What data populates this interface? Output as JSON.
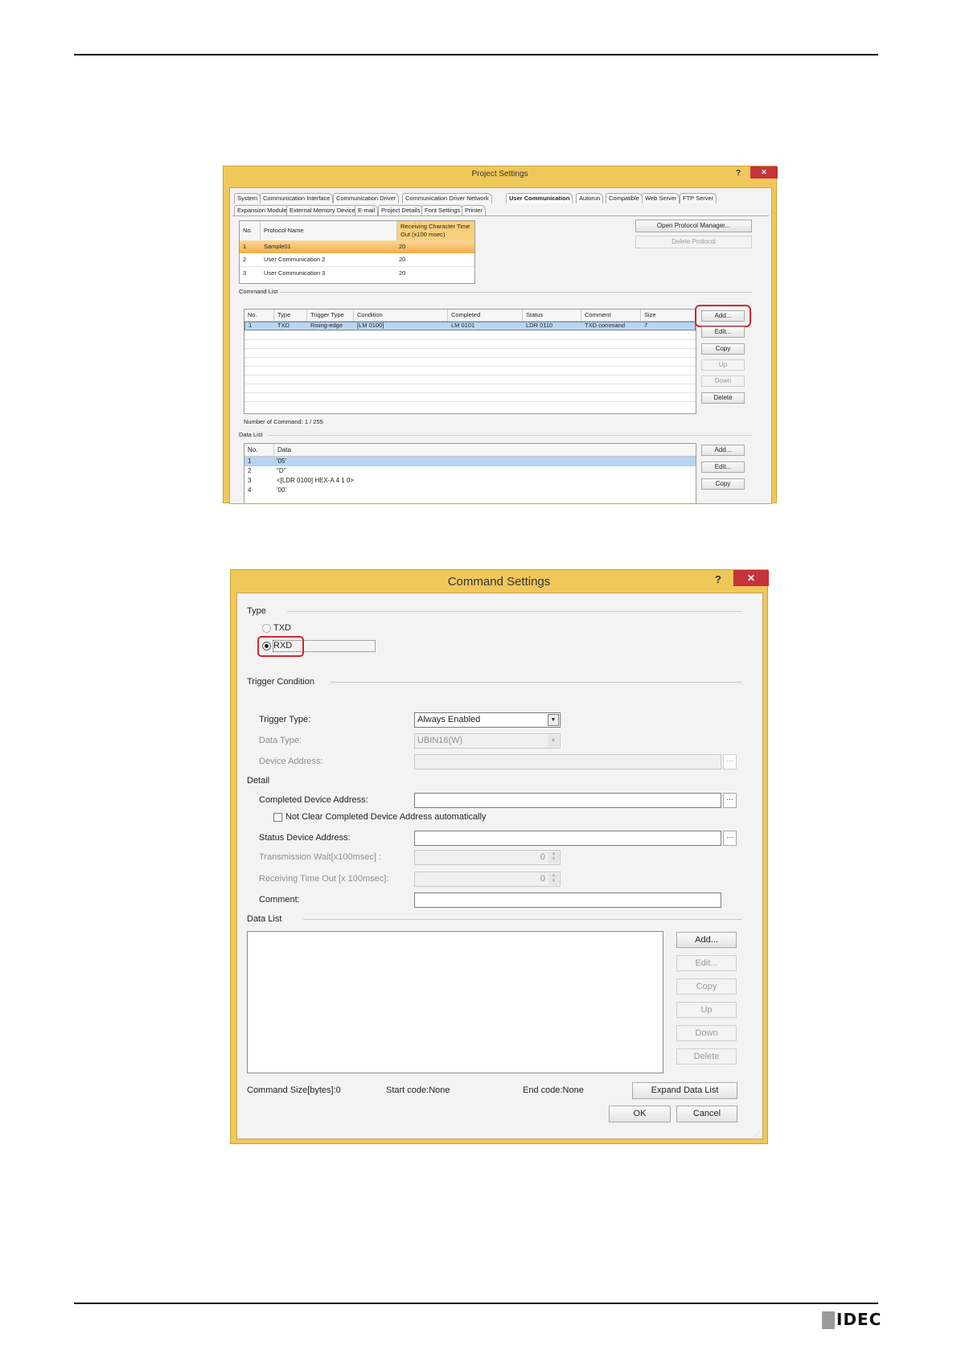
{
  "project_settings": {
    "title": "Project Settings",
    "help": "?",
    "close": "✕",
    "tabs_row1": [
      "System",
      "Communication Interface",
      "Communication Driver",
      "Communication Driver Network",
      "User Communication",
      "Autorun",
      "Compatible",
      "Web Server",
      "FTP Server"
    ],
    "tabs_row2": [
      "Expansion Module",
      "External Memory Device",
      "E-mail",
      "Project Details",
      "Font Settings",
      "Printer"
    ],
    "active_tab": "User Communication",
    "protocol_table": {
      "headers": [
        "No.",
        "Protocol Name",
        "Receiving Character Time Out (x100 msec)"
      ],
      "rows": [
        [
          "1",
          "Sample01",
          "20"
        ],
        [
          "2",
          "User Communication 2",
          "20"
        ],
        [
          "3",
          "User Communication 3",
          "20"
        ]
      ]
    },
    "open_protocol_manager": "Open Protocol Manager...",
    "delete_protocol": "Delete Protocol",
    "command_list_label": "Command List",
    "command_table": {
      "headers": [
        "No.",
        "Type",
        "Trigger Type",
        "Condition",
        "Completed",
        "Status",
        "Comment",
        "Size"
      ],
      "rows": [
        [
          "1",
          "TXD",
          "Rising-edge",
          "[LM 0100]",
          "LM 0101",
          "LDR 0110",
          "TXD command",
          "7"
        ]
      ]
    },
    "command_buttons": [
      "Add...",
      "Edit...",
      "Copy",
      "Up",
      "Down",
      "Delete"
    ],
    "number_of_command": "Number of Command: 1 / 255",
    "data_list_label": "Data List",
    "data_table": {
      "headers": [
        "No.",
        "Data"
      ],
      "rows": [
        [
          "1",
          "'05'"
        ],
        [
          "2",
          "\"D\""
        ],
        [
          "3",
          "<[LDR 0100] HEX-A 4 1 0>"
        ],
        [
          "4",
          "'00'"
        ]
      ]
    },
    "data_buttons": [
      "Add...",
      "Edit...",
      "Copy"
    ]
  },
  "command_settings": {
    "title": "Command Settings",
    "help": "?",
    "close": "✕",
    "type_label": "Type",
    "type_options": [
      "TXD",
      "RXD"
    ],
    "type_selected": "RXD",
    "trigger_condition_label": "Trigger Condition",
    "trigger_type_label": "Trigger Type:",
    "trigger_type_value": "Always Enabled",
    "data_type_label": "Data Type:",
    "data_type_value": "UBIN16(W)",
    "device_address_label": "Device Address:",
    "detail_label": "Detail",
    "completed_device_address_label": "Completed Device Address:",
    "not_clear_label": "Not Clear Completed Device Address automatically",
    "status_device_address_label": "Status Device Address:",
    "transmission_wait_label": "Transmission Wait[x100msec] :",
    "transmission_wait_value": "0",
    "receiving_timeout_label": "Receiving Time Out [x 100msec]:",
    "receiving_timeout_value": "0",
    "comment_label": "Comment:",
    "data_list_label": "Data List",
    "data_list_buttons": [
      "Add...",
      "Edit...",
      "Copy",
      "Up",
      "Down",
      "Delete"
    ],
    "command_size": "Command Size[bytes]:0",
    "start_code": "Start code:None",
    "end_code": "End code:None",
    "expand_data_list": "Expand Data List",
    "ok": "OK",
    "cancel": "Cancel"
  },
  "footer": {
    "brand": "IDEC"
  }
}
